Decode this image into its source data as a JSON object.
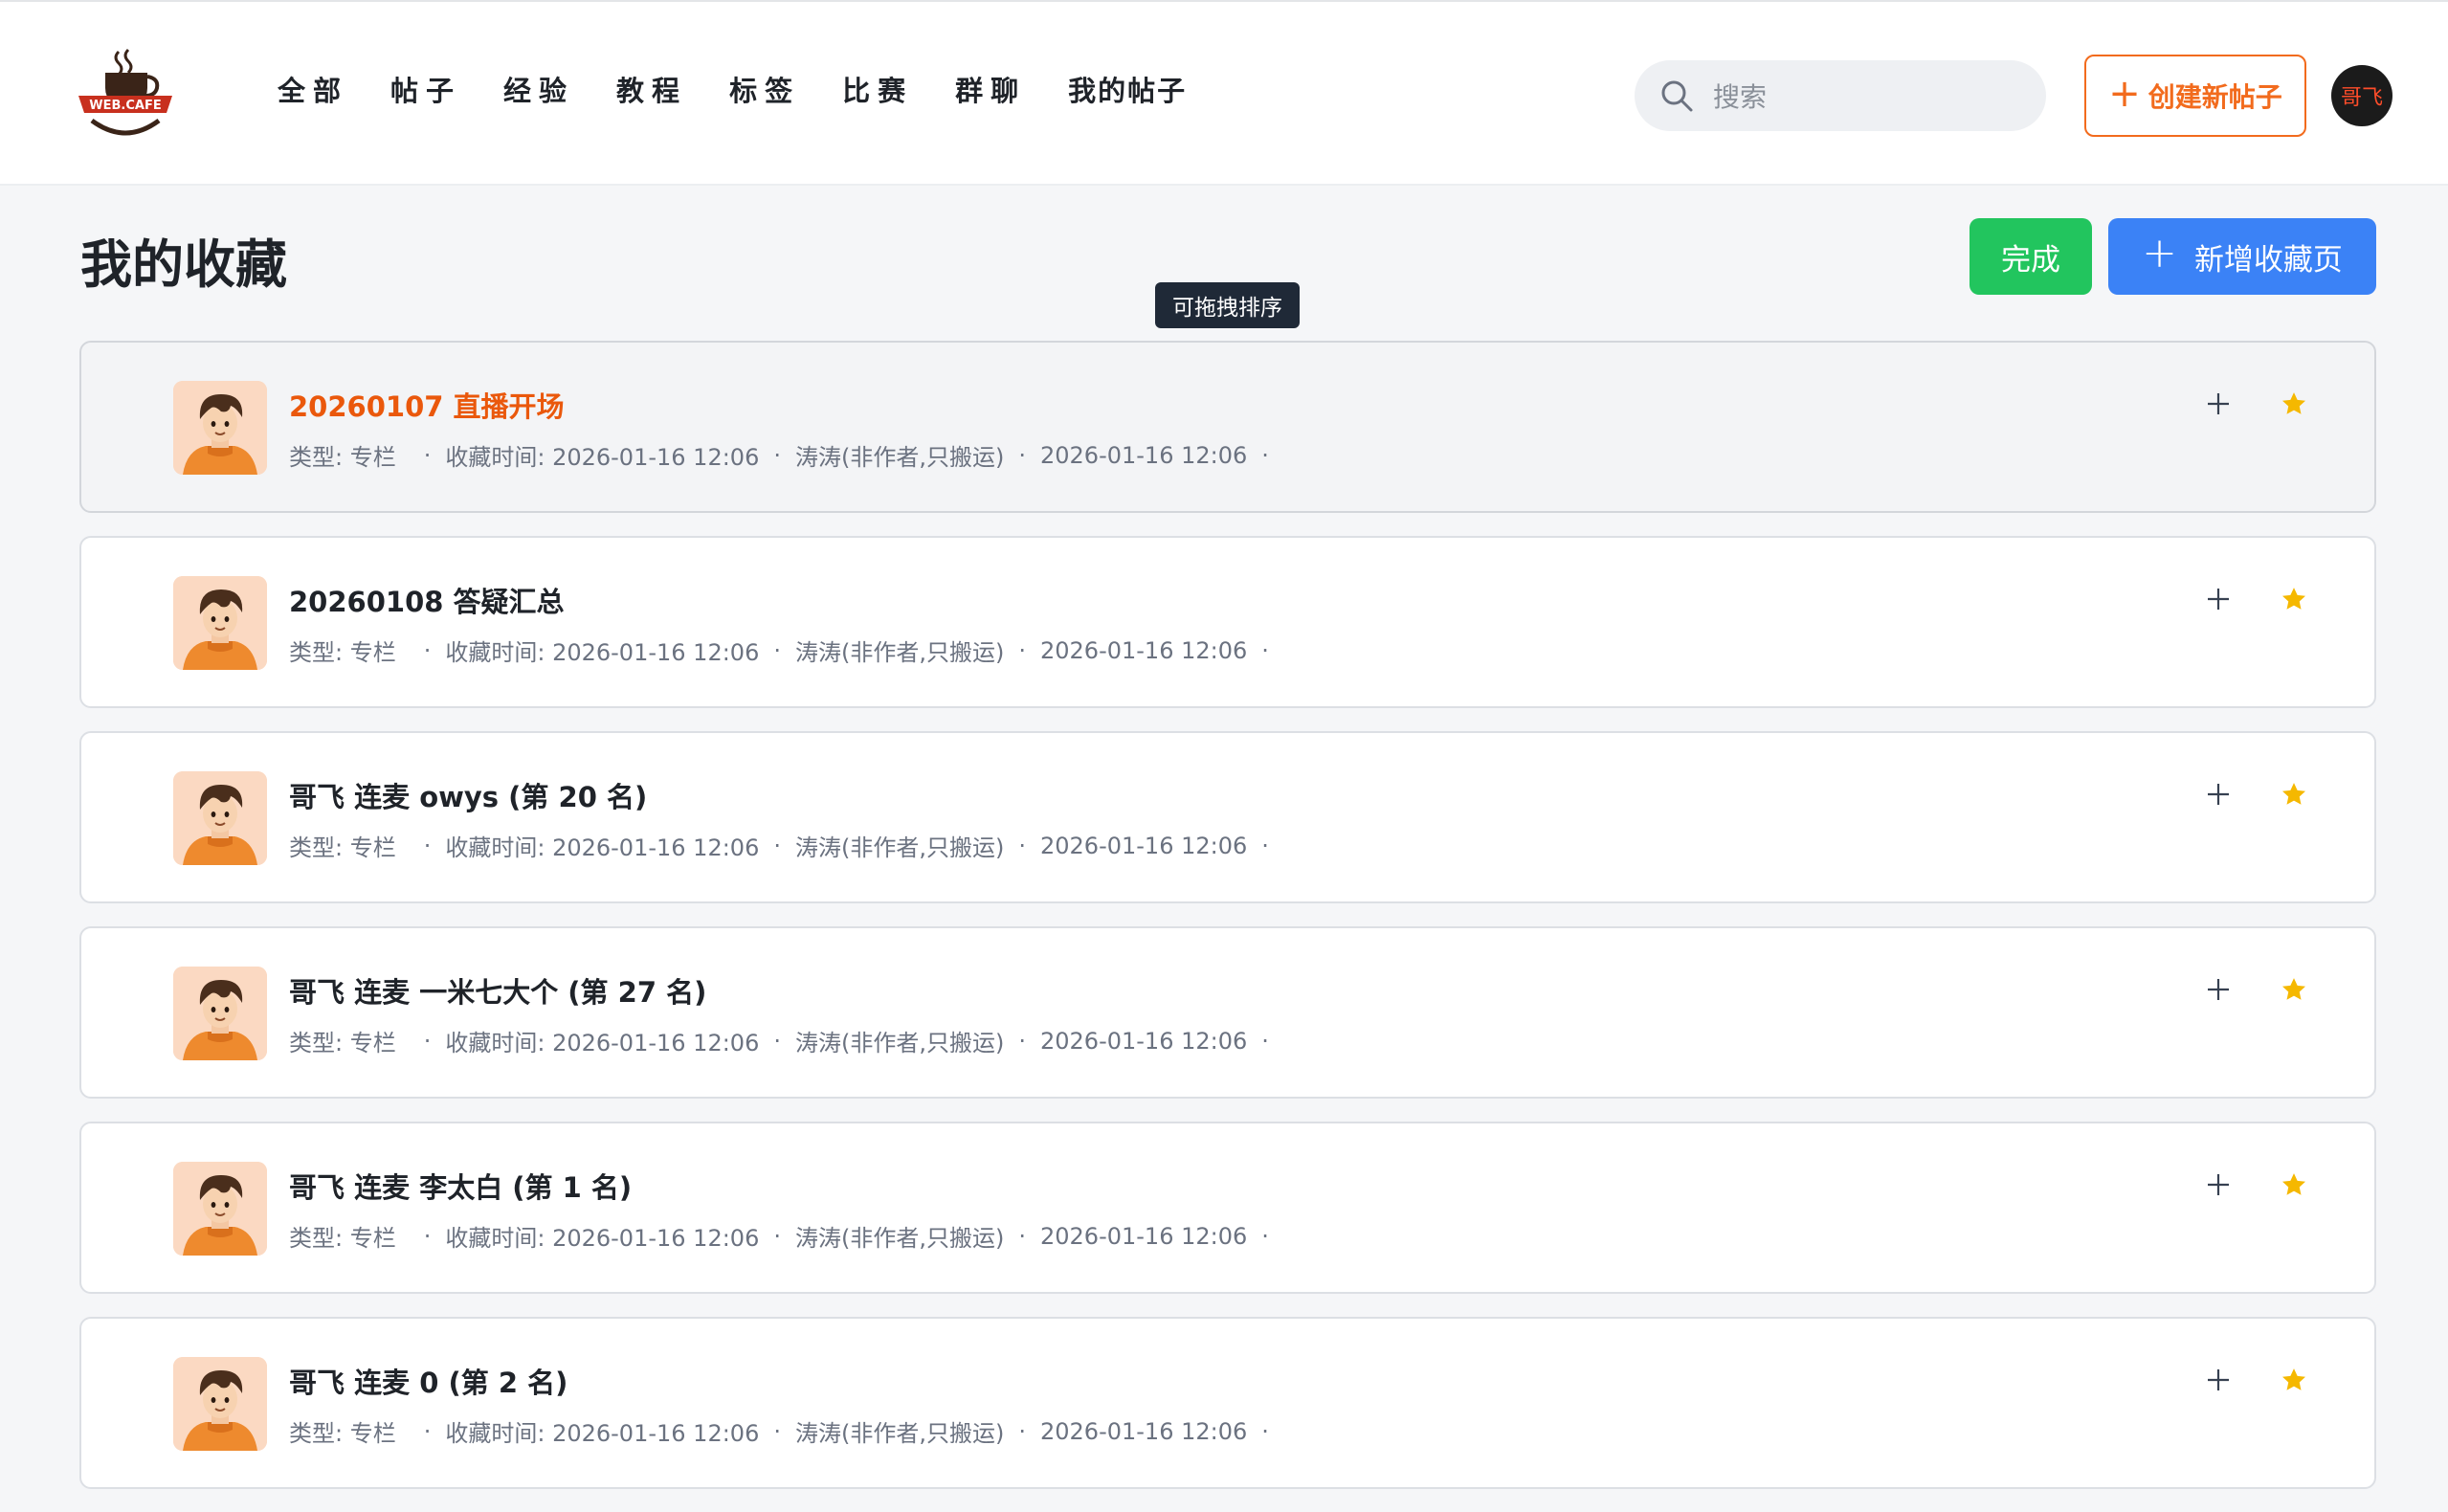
{
  "header": {
    "logo_text": "WEB.CAFE",
    "nav": [
      "全部",
      "帖子",
      "经验",
      "教程",
      "标签",
      "比赛",
      "群聊",
      "我的帖子"
    ],
    "search_placeholder": "搜索",
    "create_label": "创建新帖子",
    "user_avatar_text": "哥飞"
  },
  "page": {
    "title": "我的收藏",
    "done_label": "完成",
    "add_page_label": "新增收藏页",
    "tooltip": "可拖拽排序"
  },
  "favorites": [
    {
      "title": "20260107 直播开场",
      "type": "类型: 专栏",
      "fav_time": "收藏时间: 2026-01-16 12:06",
      "author": "涛涛(非作者,只搬运)",
      "date": "2026-01-16 12:06",
      "highlighted": true
    },
    {
      "title": "20260108 答疑汇总",
      "type": "类型: 专栏",
      "fav_time": "收藏时间: 2026-01-16 12:06",
      "author": "涛涛(非作者,只搬运)",
      "date": "2026-01-16 12:06",
      "highlighted": false
    },
    {
      "title": "哥飞 连麦 owys (第 20 名)",
      "type": "类型: 专栏",
      "fav_time": "收藏时间: 2026-01-16 12:06",
      "author": "涛涛(非作者,只搬运)",
      "date": "2026-01-16 12:06",
      "highlighted": false
    },
    {
      "title": "哥飞 连麦 一米七大个 (第 27 名)",
      "type": "类型: 专栏",
      "fav_time": "收藏时间: 2026-01-16 12:06",
      "author": "涛涛(非作者,只搬运)",
      "date": "2026-01-16 12:06",
      "highlighted": false
    },
    {
      "title": "哥飞 连麦 李太白 (第 1 名)",
      "type": "类型: 专栏",
      "fav_time": "收藏时间: 2026-01-16 12:06",
      "author": "涛涛(非作者,只搬运)",
      "date": "2026-01-16 12:06",
      "highlighted": false
    },
    {
      "title": "哥飞 连麦 0 (第 2 名)",
      "type": "类型: 专栏",
      "fav_time": "收藏时间: 2026-01-16 12:06",
      "author": "涛涛(非作者,只搬运)",
      "date": "2026-01-16 12:06",
      "highlighted": false
    }
  ],
  "colors": {
    "accent_orange": "#f26b1d",
    "done_green": "#22c55e",
    "primary_blue": "#3b82f6",
    "star_gold": "#f5b800"
  },
  "icons": {
    "logo": "coffee-cup-logo-icon",
    "search": "search-icon",
    "plus": "plus-icon",
    "star": "star-icon",
    "avatar": "cartoon-boy-avatar-icon"
  }
}
